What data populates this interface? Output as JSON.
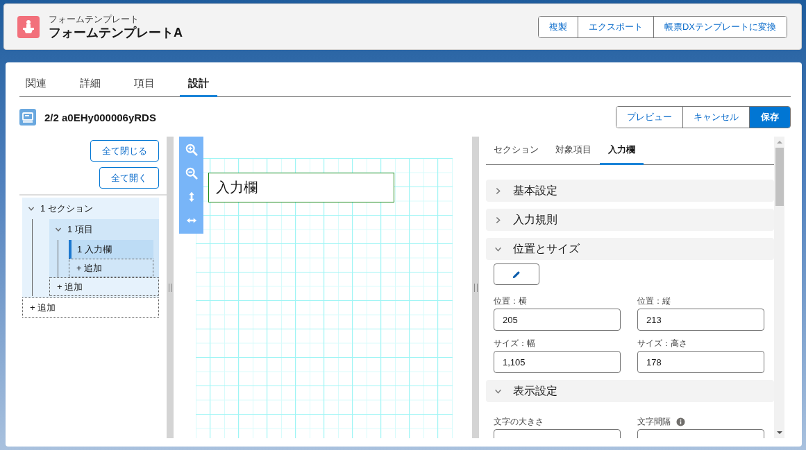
{
  "header": {
    "object_type": "フォームテンプレート",
    "title": "フォームテンプレートA",
    "actions": [
      "複製",
      "エクスポート",
      "帳票DXテンプレートに変換"
    ]
  },
  "tabs": [
    {
      "label": "関連",
      "selected": false
    },
    {
      "label": "詳細",
      "selected": false
    },
    {
      "label": "項目",
      "selected": false
    },
    {
      "label": "設計",
      "selected": true
    }
  ],
  "record": {
    "title": "2/2 a0EHy000006yRDS",
    "actions": [
      {
        "label": "プレビュー",
        "kind": "neutral"
      },
      {
        "label": "キャンセル",
        "kind": "neutral"
      },
      {
        "label": "保存",
        "kind": "brand"
      }
    ]
  },
  "outline": {
    "collapse_all": "全て閉じる",
    "expand_all": "全て開く",
    "tree": [
      {
        "kind": "node",
        "label": "1 セクション",
        "expanded": true,
        "selected": false,
        "children": [
          {
            "kind": "node",
            "label": "1 項目",
            "expanded": true,
            "selected": false,
            "children": [
              {
                "kind": "node",
                "label": "1 入力欄",
                "selected": true
              },
              {
                "kind": "add",
                "label": "+ 追加"
              }
            ]
          },
          {
            "kind": "add",
            "label": "+ 追加"
          }
        ]
      },
      {
        "kind": "add",
        "label": "+ 追加"
      }
    ]
  },
  "canvas": {
    "elements": [
      {
        "text": "入力欄"
      }
    ]
  },
  "properties": {
    "tabs": [
      {
        "label": "セクション",
        "selected": false
      },
      {
        "label": "対象項目",
        "selected": false
      },
      {
        "label": "入力欄",
        "selected": true
      }
    ],
    "sections": [
      {
        "label": "基本設定",
        "expanded": false
      },
      {
        "label": "入力規則",
        "expanded": false
      },
      {
        "label": "位置とサイズ",
        "expanded": true,
        "edit_button": true,
        "fields": [
          {
            "label": "位置：横",
            "value": "205"
          },
          {
            "label": "位置：縦",
            "value": "213"
          },
          {
            "label": "サイズ：幅",
            "value": "1,105"
          },
          {
            "label": "サイズ：高さ",
            "value": "178"
          }
        ]
      },
      {
        "label": "表示設定",
        "expanded": true,
        "fields": [
          {
            "label": "文字の大きさ"
          },
          {
            "label": "文字間隔",
            "info": true
          }
        ]
      }
    ]
  }
}
